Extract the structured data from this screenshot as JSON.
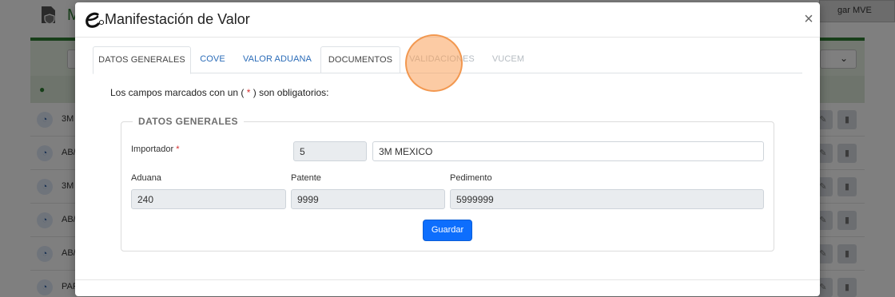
{
  "background": {
    "title_letter": "M",
    "top_button_label": "gar MVE",
    "filter_select_value": "",
    "rows": [
      {
        "text": "3M"
      },
      {
        "text": "AB/"
      },
      {
        "text": "3M"
      },
      {
        "text": "AB/"
      },
      {
        "text": "AB/"
      },
      {
        "text": "PAF"
      }
    ]
  },
  "modal": {
    "title": "Manifestación de Valor",
    "close_label": "×",
    "tabs": [
      {
        "label": "DATOS GENERALES",
        "state": "active"
      },
      {
        "label": "COVE",
        "state": "link"
      },
      {
        "label": "VALOR ADUANA",
        "state": "link"
      },
      {
        "label": "DOCUMENTOS",
        "state": "hover"
      },
      {
        "label": "VALIDACIONES",
        "state": "disabled"
      },
      {
        "label": "VUCEM",
        "state": "disabled"
      }
    ],
    "required_note_before": "Los campos marcados con un (",
    "required_star": "*",
    "required_note_after": ") son obligatorios:",
    "section_legend": "DATOS GENERALES",
    "fields": {
      "importador_label": "Importador",
      "importador_star": "*",
      "importador_code": "5",
      "importador_name": "3M MEXICO",
      "aduana_label": "Aduana",
      "aduana_value": "240",
      "patente_label": "Patente",
      "patente_value": "9999",
      "pedimento_label": "Pedimento",
      "pedimento_value": "5999999"
    },
    "save_label": "Guardar"
  },
  "colors": {
    "primary": "#0d6efd",
    "link": "#2b6cb8",
    "required": "#d32f2f",
    "brand_green": "#2e7d32"
  }
}
